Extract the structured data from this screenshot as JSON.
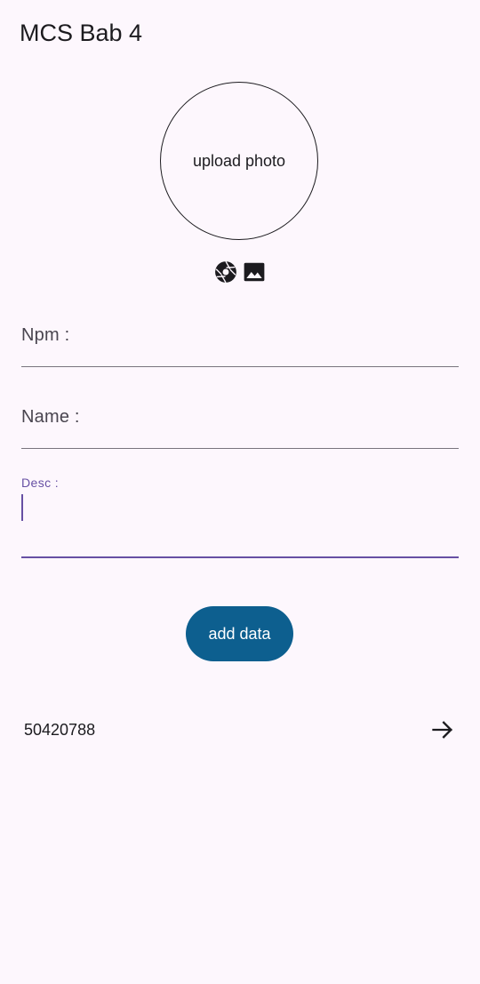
{
  "app_bar": {
    "title": "MCS Bab 4"
  },
  "photo": {
    "label": "upload photo",
    "camera_icon": "camera-shutter-icon",
    "gallery_icon": "image-gallery-icon"
  },
  "form": {
    "npm_label": "Npm :",
    "name_label": "Name :",
    "desc_label": "Desc :",
    "npm_value": "",
    "name_value": "",
    "desc_value": ""
  },
  "actions": {
    "add_label": "add data"
  },
  "list": {
    "items": [
      {
        "text": "50420788",
        "icon": "arrow-forward-icon"
      }
    ]
  },
  "colors": {
    "background": "#fdf7fd",
    "primary_button": "#0d5f8f",
    "focus_accent": "#6750a4",
    "text": "#1c1b1f"
  }
}
